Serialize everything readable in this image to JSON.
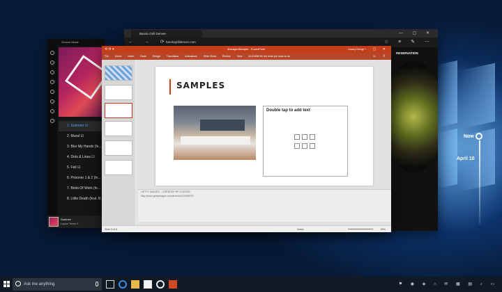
{
  "groove": {
    "title": "Groove Music",
    "tracks": [
      {
        "label": "1.  Summer  ☑",
        "selected": true
      },
      {
        "label": "2.  Mural  ☑",
        "selected": false
      },
      {
        "label": "3.  Blur My Hands (fe...",
        "selected": false
      },
      {
        "label": "4.  Dots & Lines  ☑",
        "selected": false
      },
      {
        "label": "5.  Fall  ☑",
        "selected": false
      },
      {
        "label": "6.  Prisoner 1 & 2 (fe...",
        "selected": false
      },
      {
        "label": "7.  Birds Of Work (fe...",
        "selected": false
      },
      {
        "label": "8.  Little Death (feat. B...",
        "selected": false
      }
    ],
    "now_playing_title": "Summer",
    "now_playing_artist": "Lapse Years 2"
  },
  "edge": {
    "tab_title": "Barolo Grill Denver",
    "url": "barologrilldenver.com",
    "page_menu_item": "RESERVATION"
  },
  "powerpoint": {
    "window_title": "ManagedSample - PowerPoint",
    "user": "Linsey Deng",
    "ribbon_tabs": [
      "File",
      "Home",
      "Insert",
      "Draw",
      "Design",
      "Transitions",
      "Animations",
      "Slide Show",
      "Review",
      "View",
      "ALCDEM"
    ],
    "tell_me": "♀ Tell me what you want to do",
    "slide_title": "SAMPLES",
    "placeholder_text": "Double tap to add text",
    "notes_line1": "GETTY IMAGES – CREATIVE RF LICENSE",
    "notes_line2": "http://www.gettyimages.com/license/123456797",
    "status_slide": "Slide 3 of 6",
    "status_notes": "Notes",
    "zoom": "69%"
  },
  "timeline": {
    "now_label": "Now",
    "date_label": "April 10"
  },
  "taskbar": {
    "search_placeholder": "Ask me anything"
  }
}
